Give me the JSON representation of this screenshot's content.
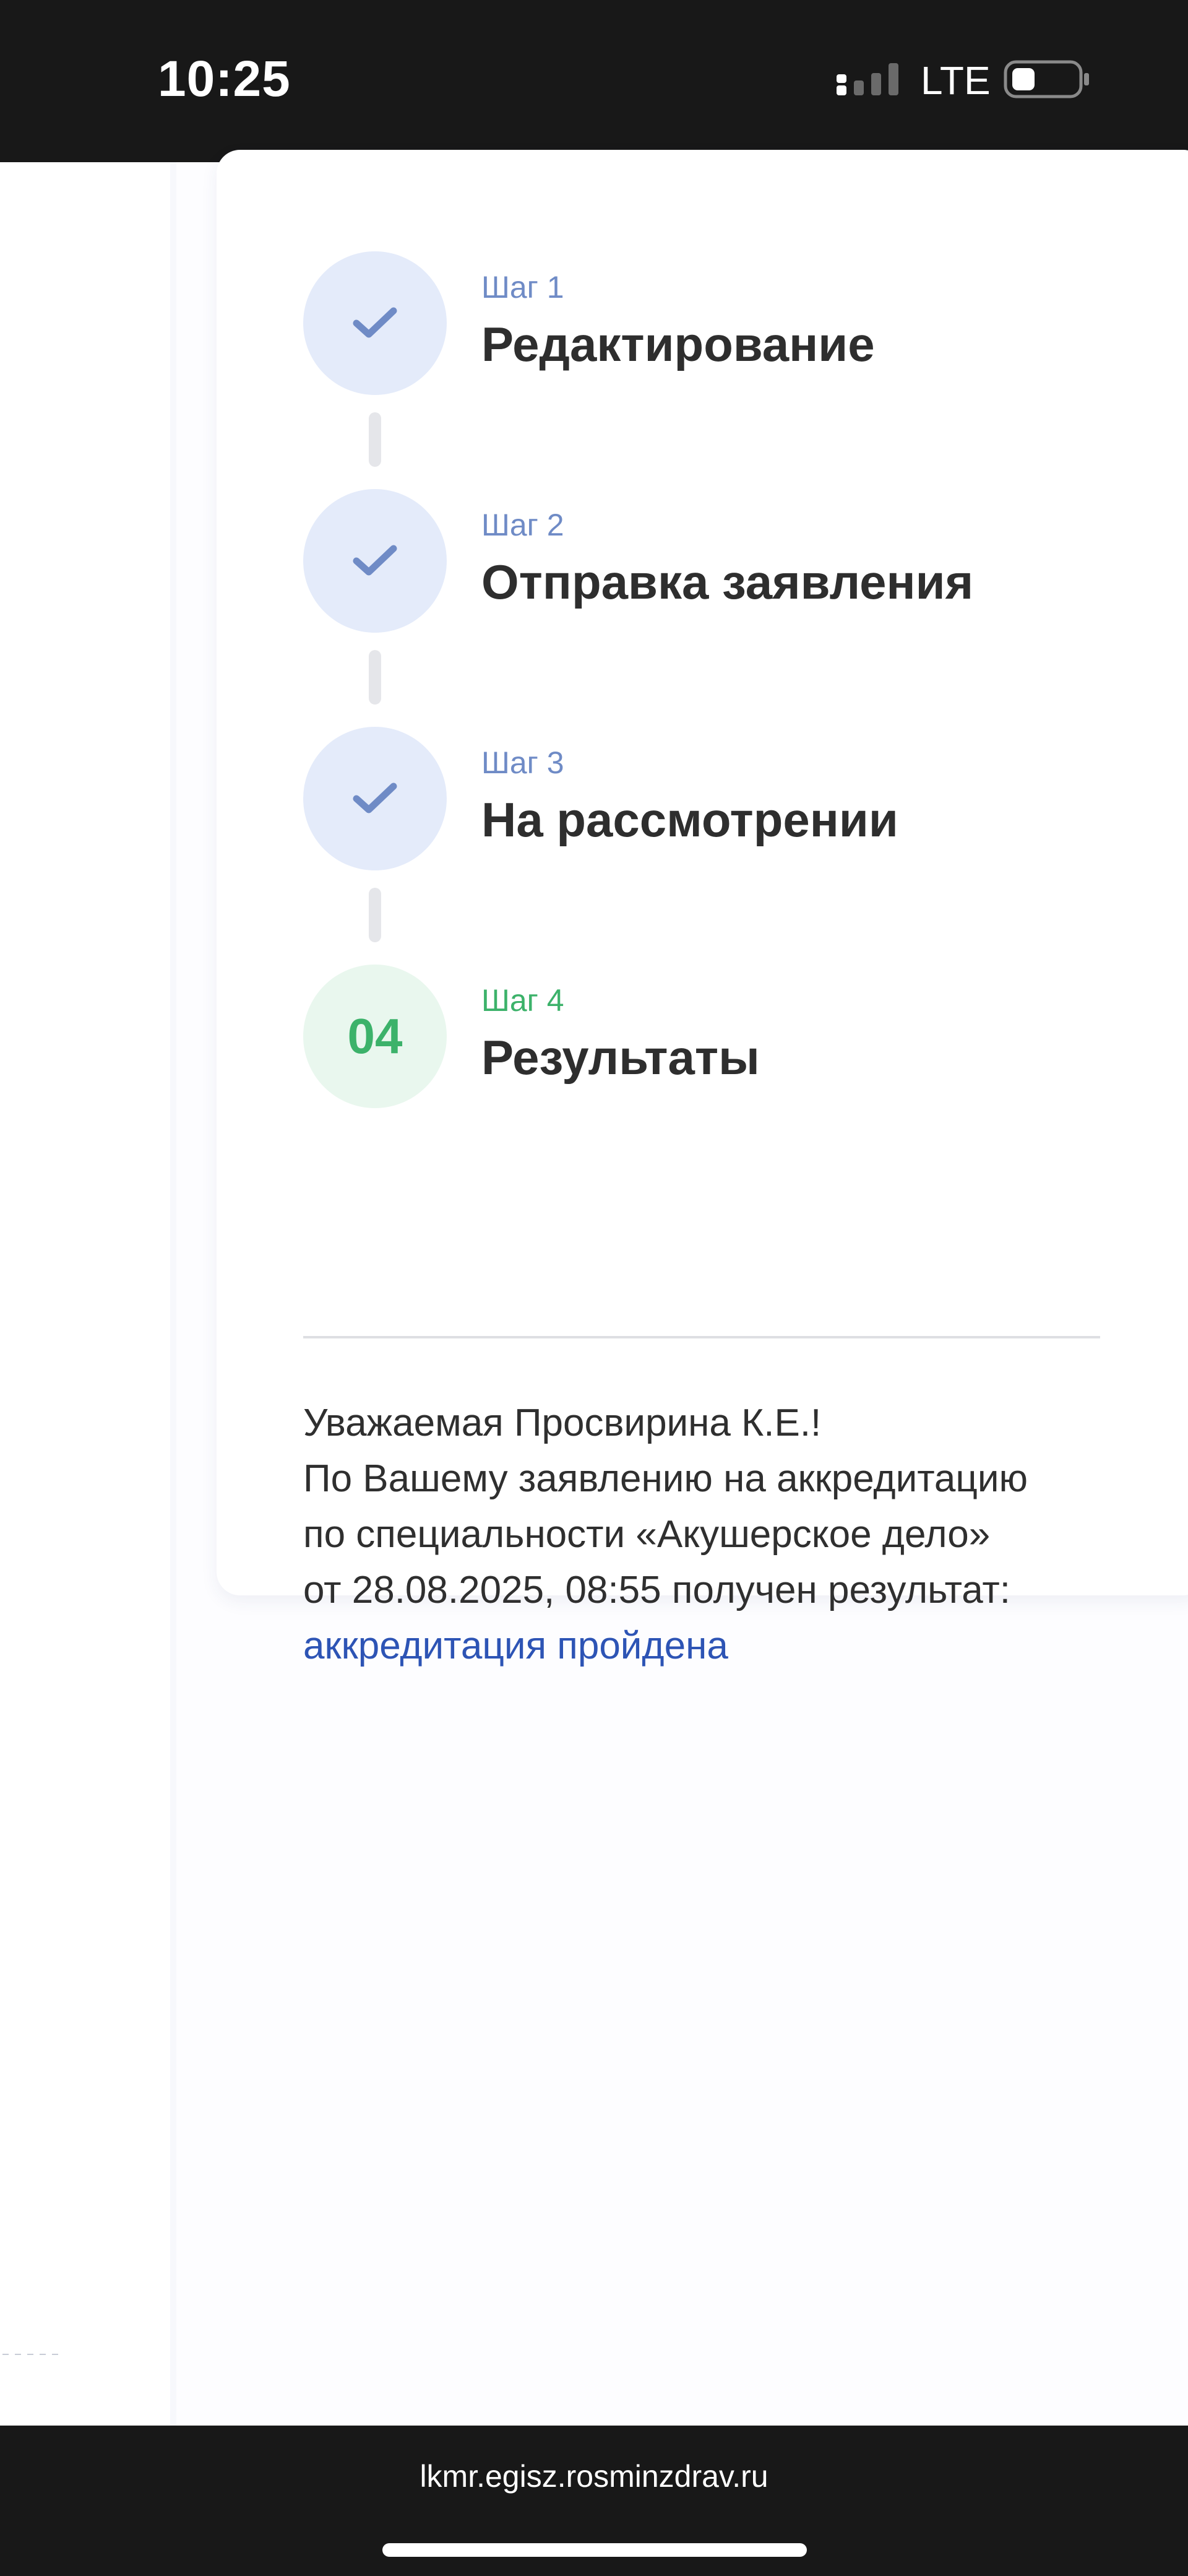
{
  "status_bar": {
    "time": "10:25",
    "network": "LTE",
    "signal_icon": "cellular-signal-icon",
    "battery_icon": "battery-low-icon"
  },
  "steps": [
    {
      "label": "Шаг 1",
      "title": "Редактирование",
      "state": "done",
      "icon": "checkmark-icon"
    },
    {
      "label": "Шаг 2",
      "title": "Отправка заявления",
      "state": "done",
      "icon": "checkmark-icon"
    },
    {
      "label": "Шаг 3",
      "title": "На рассмотрении",
      "state": "done",
      "icon": "checkmark-icon"
    },
    {
      "label": "Шаг 4",
      "title": "Результаты",
      "state": "current",
      "number": "04"
    }
  ],
  "message": {
    "line1": "Уважаемая Просвирина К.Е.!",
    "line2": "По Вашему заявлению на аккредитацию",
    "line3": "по специальности «Акушерское дело»",
    "line4": "от 28.08.2025, 08:55 получен результат:",
    "result": "аккредитация пройдена"
  },
  "browser": {
    "url": "lkmr.egisz.rosminzdrav.ru"
  },
  "colors": {
    "done_circle": "#e4ebfa",
    "done_check": "#6f8bc6",
    "current_circle": "#e9f7ee",
    "current_accent": "#3cb26a",
    "link": "#2d54b5",
    "title_text": "#2e2e2e"
  }
}
